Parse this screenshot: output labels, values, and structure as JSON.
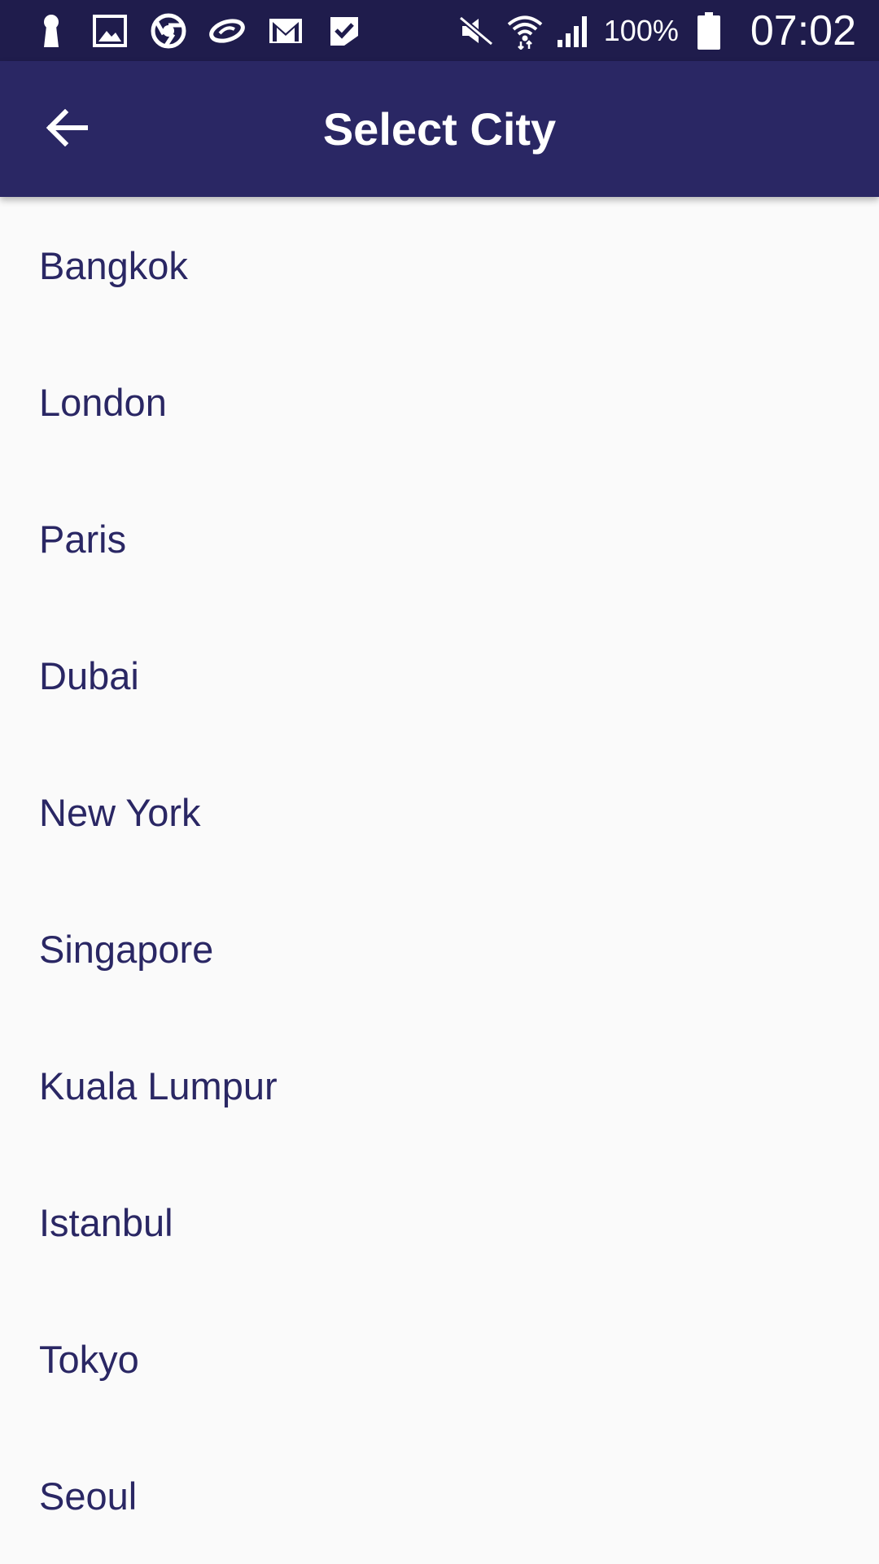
{
  "status_bar": {
    "notification_icons": [
      "keyhole-icon",
      "gallery-icon",
      "chrome-icon",
      "swirl-app-icon",
      "gmail-icon",
      "task-check-icon"
    ],
    "system_icons": [
      "mute-icon",
      "wifi-icon",
      "signal-icon",
      "battery-icon"
    ],
    "battery_percent": "100%",
    "time": "07:02"
  },
  "app_bar": {
    "title": "Select City",
    "back_icon": "arrow-back-icon"
  },
  "cities": [
    {
      "label": "Bangkok"
    },
    {
      "label": "London"
    },
    {
      "label": "Paris"
    },
    {
      "label": "Dubai"
    },
    {
      "label": "New York"
    },
    {
      "label": "Singapore"
    },
    {
      "label": "Kuala Lumpur"
    },
    {
      "label": "Istanbul"
    },
    {
      "label": "Tokyo"
    },
    {
      "label": "Seoul"
    }
  ],
  "colors": {
    "status_bar": "#1f1c4c",
    "app_bar": "#2a2764",
    "list_text": "#2a2764",
    "background": "#fafafa"
  }
}
